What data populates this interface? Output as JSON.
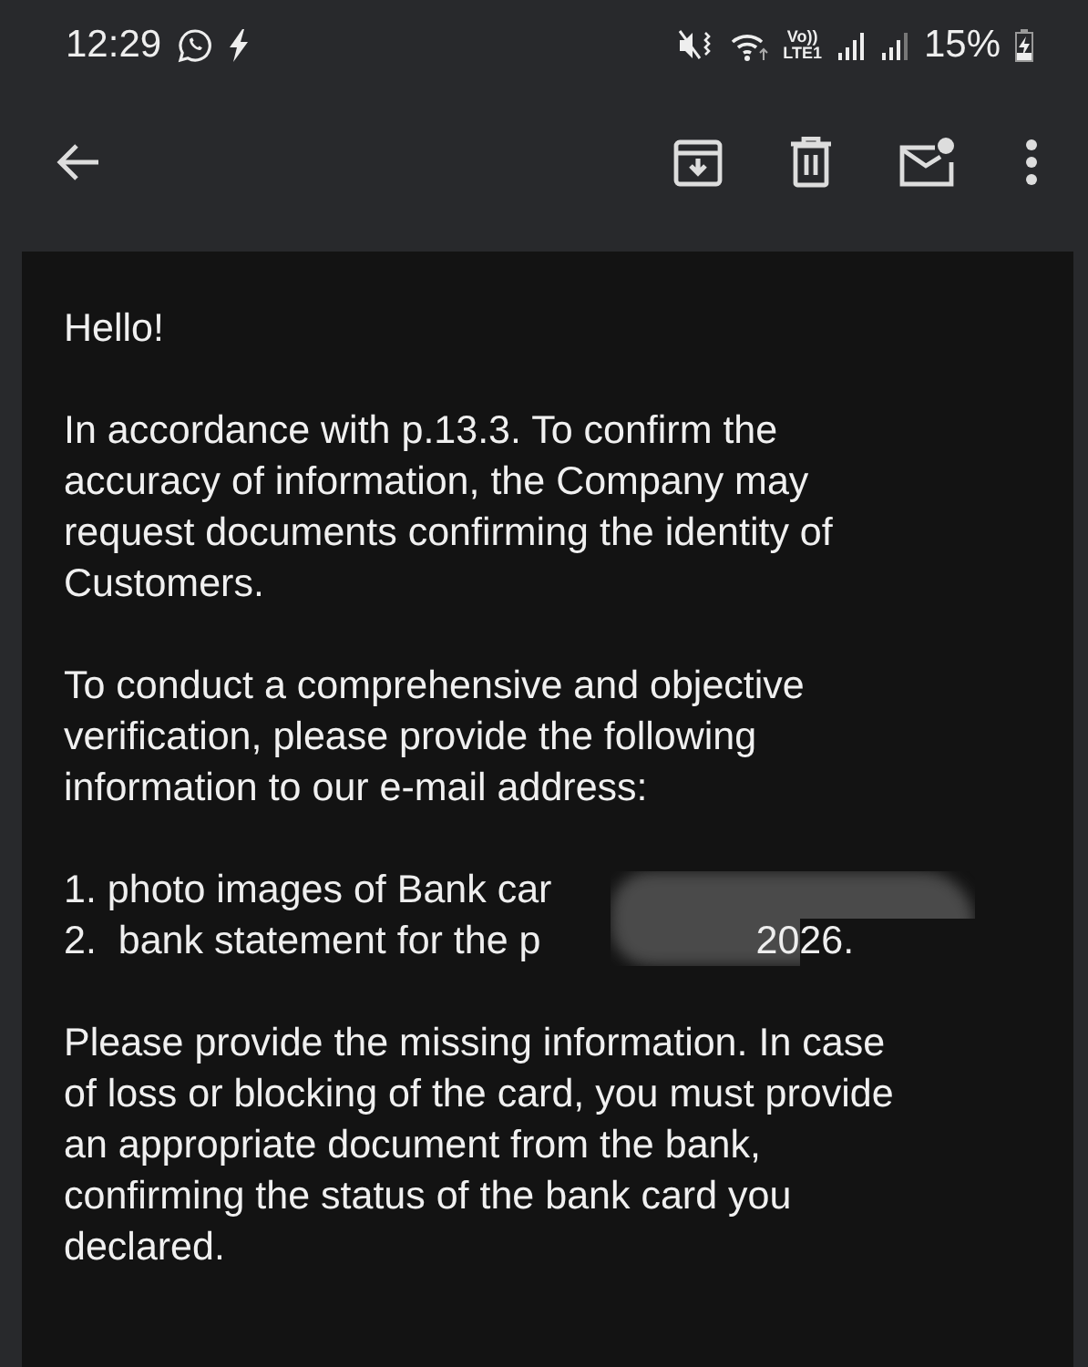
{
  "status_bar": {
    "time": "12:29",
    "network_label": "Vo))\nLTE1",
    "battery": "15%"
  },
  "toolbar": {
    "actions": [
      {
        "kind": "archive"
      },
      {
        "kind": "delete"
      },
      {
        "kind": "mark-unread"
      },
      {
        "kind": "more"
      }
    ]
  },
  "message": {
    "greeting": "Hello!",
    "paragraphs": [
      "In accordance with p.13.3. To confirm the accuracy of information, the Company may request documents confirming the identity of Customers.",
      "To conduct a comprehensive and objective verification, please provide the following information to our e-mail address:"
    ],
    "list": [
      {
        "text": "1. photo images of Bank car"
      },
      {
        "text": "2.  bank statement for the p",
        "tail": "2026."
      }
    ],
    "closing": "Please provide the missing information. In case of loss or blocking of the card, you must provide an appropriate document from the bank, confirming the status of the bank card you declared."
  }
}
